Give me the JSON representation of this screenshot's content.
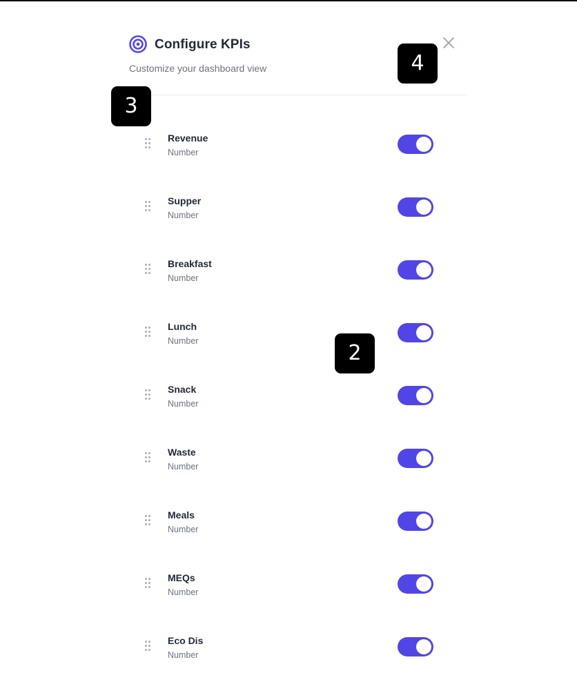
{
  "header": {
    "title": "Configure KPIs",
    "subtitle": "Customize your dashboard view",
    "icon": "target-icon",
    "close_icon": "close-icon"
  },
  "colors": {
    "accent": "#5146e5",
    "title": "#1f2937",
    "muted": "#6b7280",
    "badge": "#000000"
  },
  "kpis": [
    {
      "name": "Revenue",
      "type": "Number",
      "enabled": true
    },
    {
      "name": "Supper",
      "type": "Number",
      "enabled": true
    },
    {
      "name": "Breakfast",
      "type": "Number",
      "enabled": true
    },
    {
      "name": "Lunch",
      "type": "Number",
      "enabled": true
    },
    {
      "name": "Snack",
      "type": "Number",
      "enabled": true
    },
    {
      "name": "Waste",
      "type": "Number",
      "enabled": true
    },
    {
      "name": "Meals",
      "type": "Number",
      "enabled": true
    },
    {
      "name": "MEQs",
      "type": "Number",
      "enabled": true
    },
    {
      "name": "Eco Dis",
      "type": "Number",
      "enabled": true
    }
  ],
  "badges": {
    "b2": "2",
    "b3": "3",
    "b4": "4"
  }
}
